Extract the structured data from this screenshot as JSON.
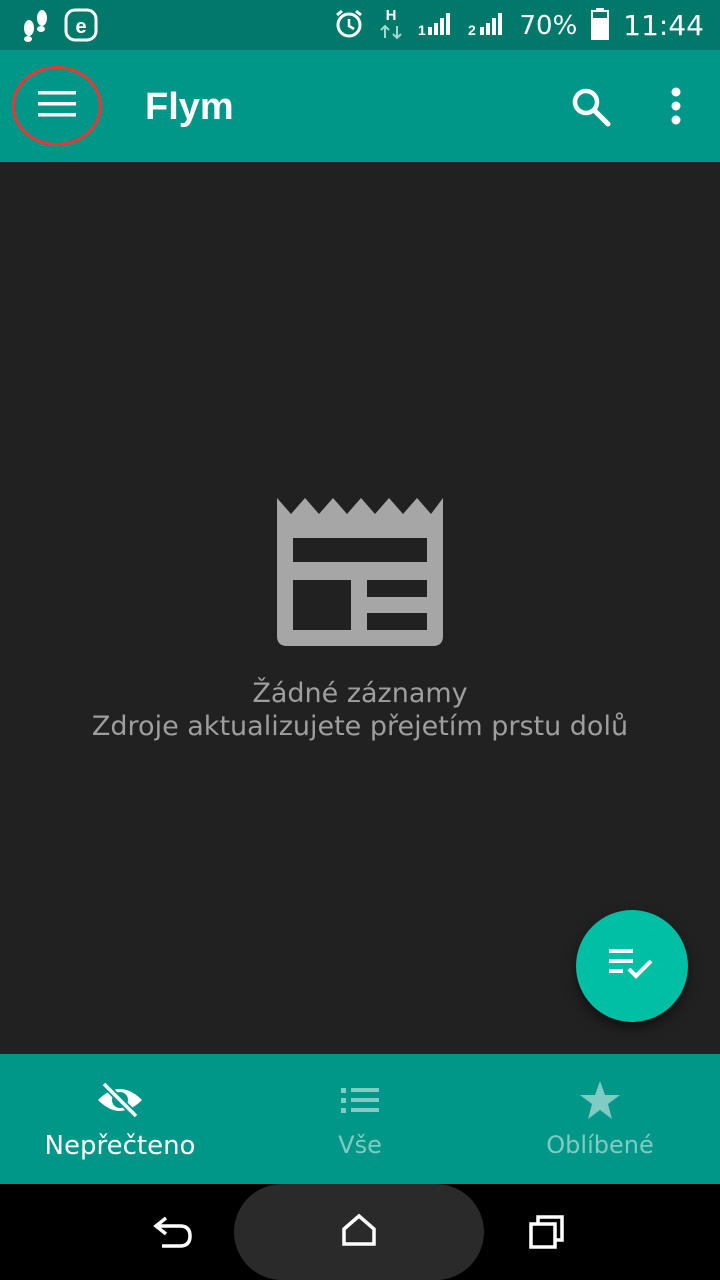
{
  "status_bar": {
    "battery": "70%",
    "time": "11:44",
    "icons": [
      "footprints-icon",
      "eset-icon",
      "alarm-icon",
      "h-network-icon",
      "signal-1-icon",
      "signal-2-icon",
      "battery-icon"
    ]
  },
  "app_bar": {
    "title": "Flym",
    "icons": [
      "menu-icon",
      "search-icon",
      "more-vert-icon"
    ]
  },
  "empty_state": {
    "title": "Žádné záznamy",
    "subtitle": "Zdroje aktualizujete přejetím prstu dolů",
    "icon": "news-feed-icon"
  },
  "fab": {
    "icon": "mark-all-read-icon"
  },
  "bottom_nav": {
    "items": [
      {
        "label": "Nepřečteno",
        "icon": "eye-off-icon",
        "active": true
      },
      {
        "label": "Vše",
        "icon": "list-icon",
        "active": false
      },
      {
        "label": "Oblíbené",
        "icon": "star-icon",
        "active": false
      }
    ]
  },
  "system_nav": {
    "icons": [
      "back-icon",
      "home-icon",
      "recents-icon"
    ]
  },
  "colors": {
    "status_bar": "#00796b",
    "primary": "#009688",
    "accent": "#00bfa5",
    "background": "#212121",
    "highlight_ring": "#e53935"
  }
}
